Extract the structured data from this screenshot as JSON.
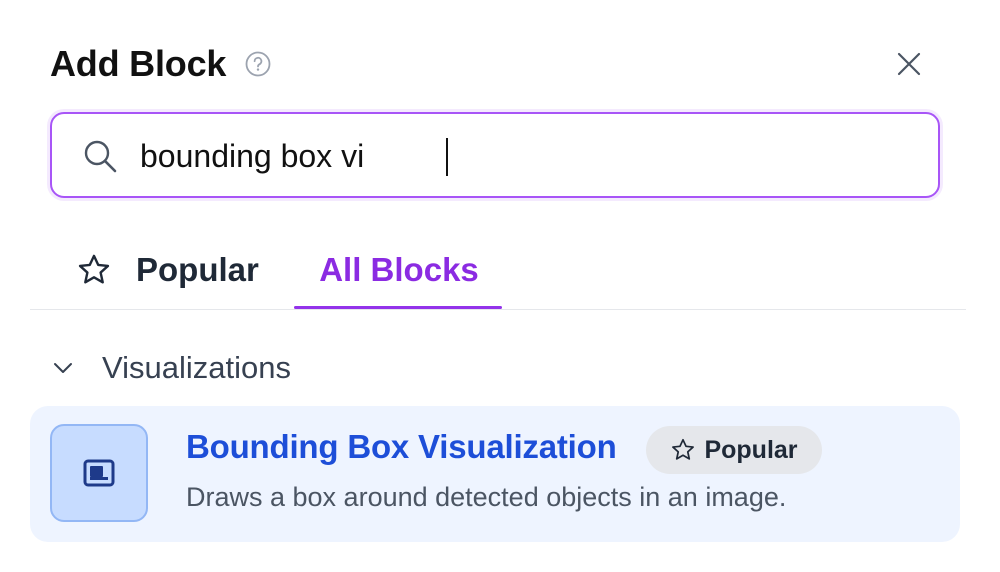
{
  "header": {
    "title": "Add Block"
  },
  "search": {
    "value": "bounding box vi"
  },
  "tabs": [
    {
      "label": "Popular",
      "icon": "star-outline-icon"
    },
    {
      "label": "All Blocks",
      "active": true
    }
  ],
  "section": {
    "title": "Visualizations"
  },
  "results": [
    {
      "name": "Bounding Box Visualization",
      "badge": "Popular",
      "description": "Draws a box around detected objects in an image.",
      "icon": "bounding-box-icon"
    }
  ],
  "colors": {
    "accent": "#9333ea",
    "link": "#1d4ed8",
    "card_bg": "#eef4ff",
    "icon_bg": "#c7dcff"
  }
}
